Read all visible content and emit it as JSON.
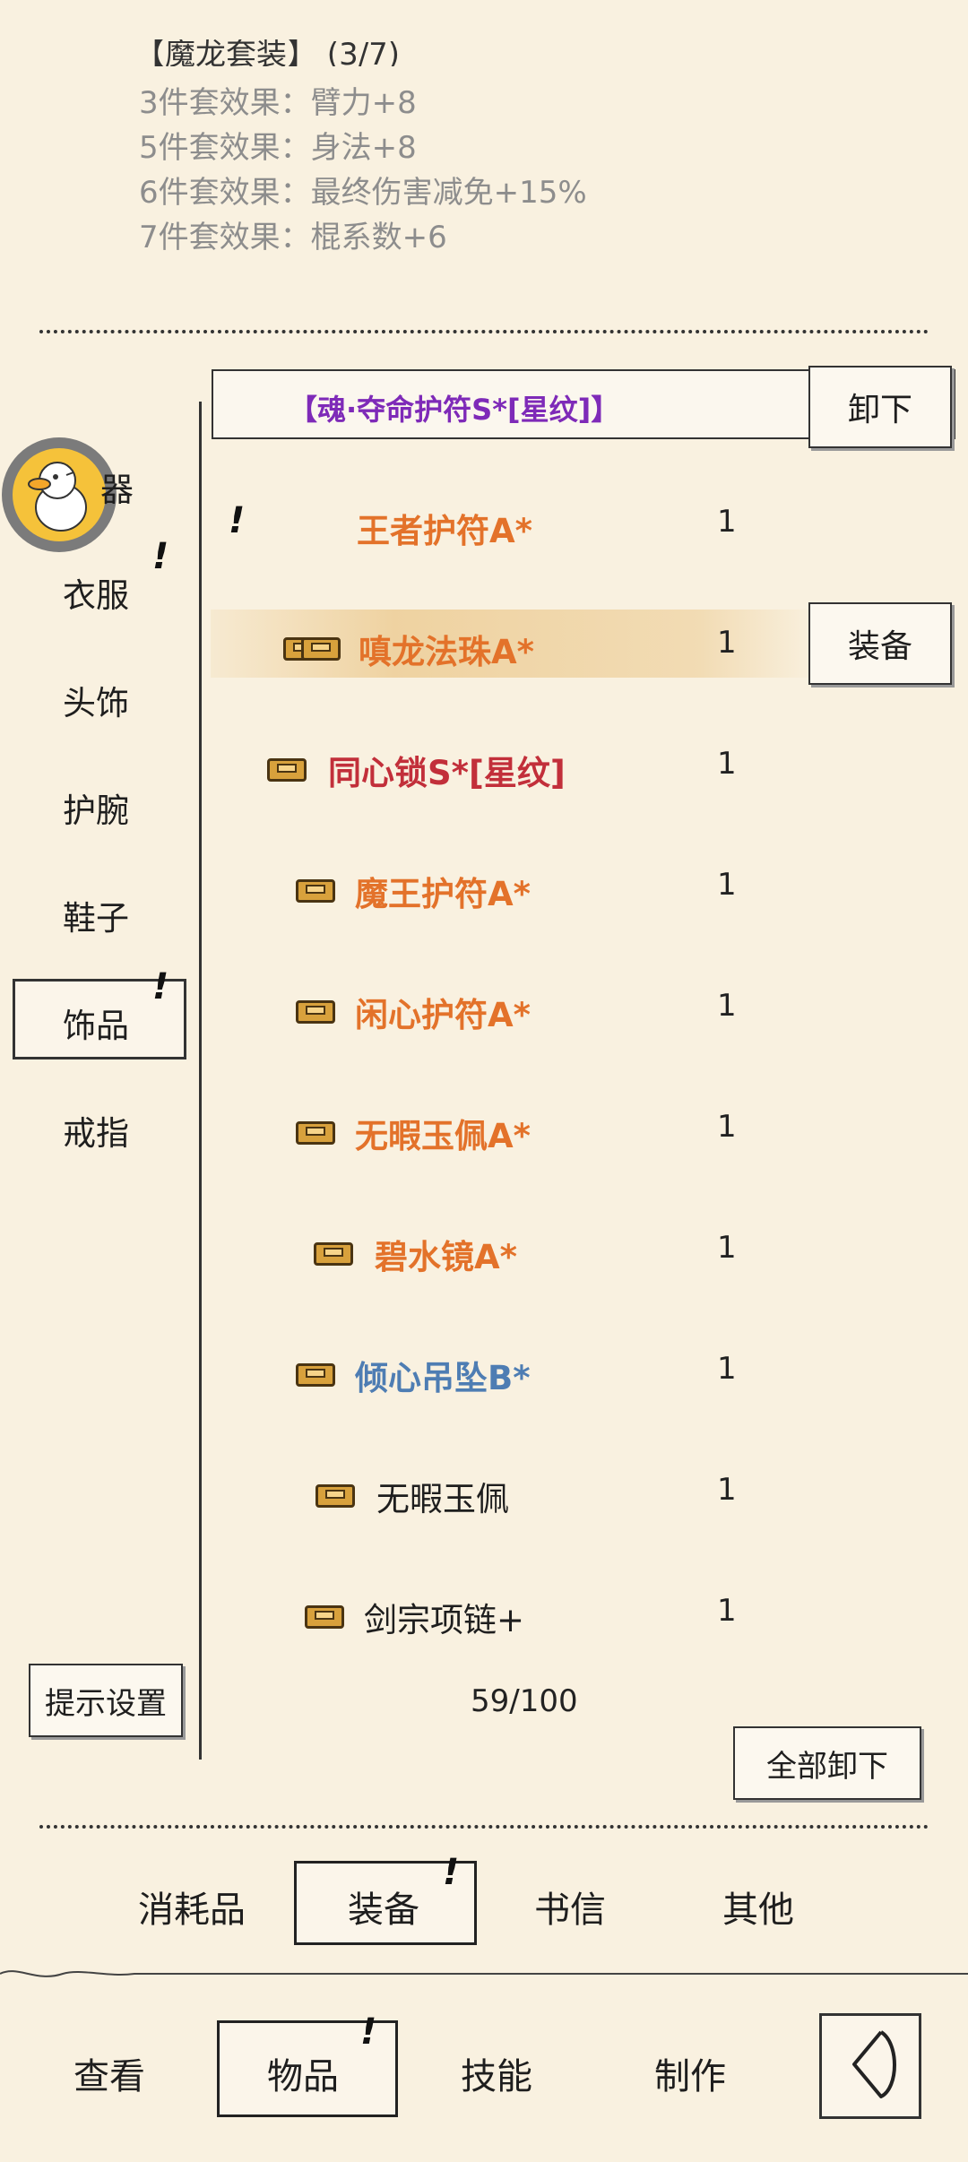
{
  "set_bonus": {
    "header_partial": "【魔龙套装】 (3/7)",
    "lines": [
      "3件套效果：臂力+8",
      "5件套效果：身法+8",
      "6件套效果：最终伤害减免+15%",
      "7件套效果：棍系数+6"
    ]
  },
  "equipped": {
    "name": "【魂·夺命护符S*[星纹]】",
    "unequip_label": "卸下"
  },
  "categories": [
    "器",
    "衣服",
    "头饰",
    "护腕",
    "鞋子",
    "饰品",
    "戒指"
  ],
  "selected_category": "饰品",
  "items": [
    {
      "name": "王者护符A*",
      "count": "1",
      "color": "orange"
    },
    {
      "name": "嗔龙法珠A*",
      "count": "1",
      "color": "orange"
    },
    {
      "name": "同心锁S*[星纹]",
      "count": "1",
      "color": "red"
    },
    {
      "name": "魔王护符A*",
      "count": "1",
      "color": "orange"
    },
    {
      "name": "闲心护符A*",
      "count": "1",
      "color": "orange"
    },
    {
      "name": "无暇玉佩A*",
      "count": "1",
      "color": "orange"
    },
    {
      "name": "碧水镜A*",
      "count": "1",
      "color": "orange"
    },
    {
      "name": "倾心吊坠B*",
      "count": "1",
      "color": "blue"
    },
    {
      "name": "无暇玉佩",
      "count": "1",
      "color": "black"
    },
    {
      "name": "剑宗项链+",
      "count": "1",
      "color": "black"
    }
  ],
  "equip_label": "装备",
  "hint_settings_label": "提示设置",
  "capacity": "59/100",
  "unequip_all_label": "全部卸下",
  "bag_tabs": [
    "消耗品",
    "装备",
    "书信",
    "其他"
  ],
  "bag_tab_selected": "装备",
  "nav_tabs": [
    "查看",
    "物品",
    "技能",
    "制作"
  ],
  "nav_tab_selected": "物品",
  "back_icon": "back-arrow-icon",
  "alert_mark": "!",
  "colors": {
    "background": "#f9f1e0",
    "orange": "#e3722a",
    "red": "#c22f3a",
    "blue": "#4e7db3",
    "purple": "#7e2ab8"
  }
}
